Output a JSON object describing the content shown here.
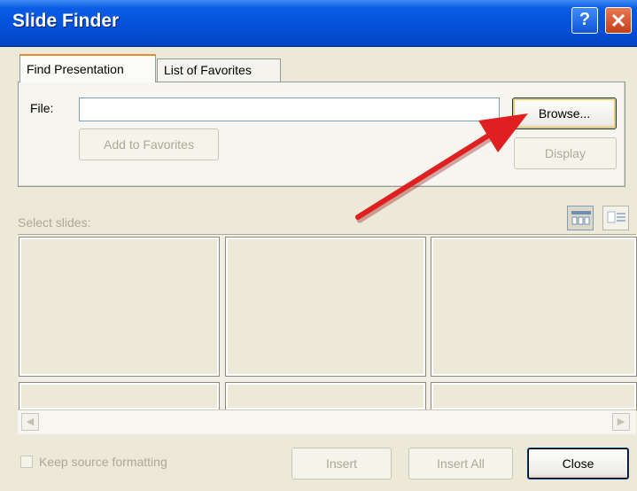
{
  "window": {
    "title": "Slide Finder"
  },
  "tabs": [
    {
      "label": "Find Presentation",
      "active": true
    },
    {
      "label": "List of Favorites",
      "active": false
    }
  ],
  "file": {
    "label": "File:",
    "value": "",
    "browse_label": "Browse...",
    "add_favorites_label": "Add to Favorites",
    "display_label": "Display"
  },
  "slides": {
    "select_label": "Select slides:"
  },
  "footer": {
    "keep_formatting_label": "Keep source formatting",
    "keep_formatting_checked": false,
    "insert_label": "Insert",
    "insert_all_label": "Insert All",
    "close_label": "Close"
  },
  "colors": {
    "titlebar": "#0450d8",
    "annotation_arrow": "#e02020"
  }
}
